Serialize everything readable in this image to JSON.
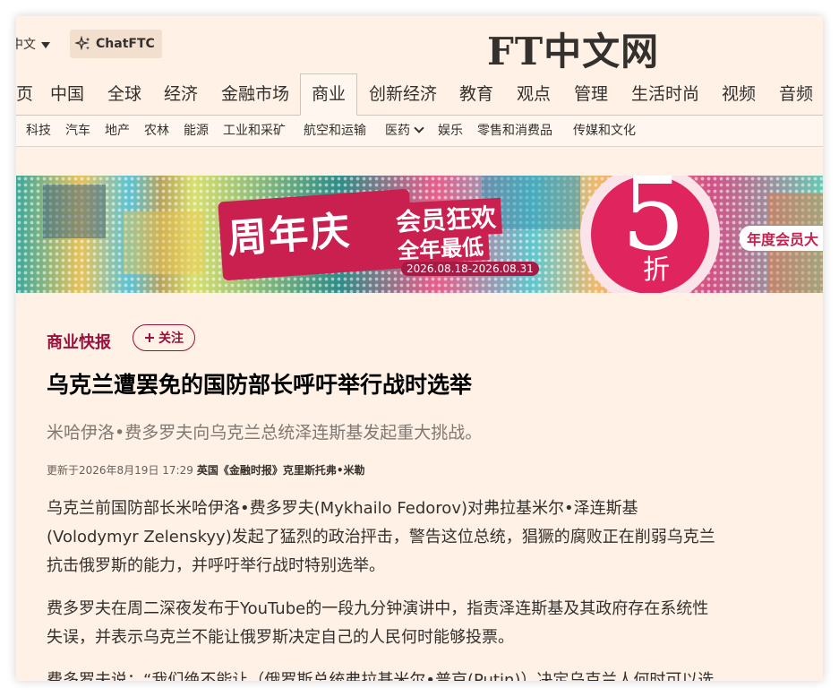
{
  "header": {
    "language_label": "中文",
    "chatftc_label": "ChatFTC",
    "logo": "FT中文网"
  },
  "main_nav": [
    "页",
    "中国",
    "全球",
    "经济",
    "金融市场",
    "商业",
    "创新经济",
    "教育",
    "观点",
    "管理",
    "生活时尚",
    "视频",
    "音频"
  ],
  "main_nav_active": "商业",
  "sub_nav": [
    "科技",
    "汽车",
    "地产",
    "农林",
    "能源",
    "工业和采矿",
    "航空和运输",
    "医药",
    "娱乐",
    "零售和消费品",
    "传媒和文化"
  ],
  "banner": {
    "title": "周年庆",
    "line1": "会员狂欢",
    "line2": "全年最低",
    "dates": "2026.08.18-2026.08.31",
    "discount_number": "5",
    "discount_unit": "折",
    "side_text": "年度会员大"
  },
  "article": {
    "kicker": "商业快报",
    "follow_label": "关注",
    "headline": "乌克兰遭罢免的国防部长呼吁举行战时选举",
    "standfirst": "米哈伊洛•费多罗夫向乌克兰总统泽连斯基发起重大挑战。",
    "updated": "更新于2026年8月19日 17:29",
    "author": "英国《金融时报》克里斯托弗•米勒",
    "paragraphs": [
      [
        "乌克兰前国防部长米哈伊洛•费多罗夫(Mykhailo Fedorov)对弗拉基米尔•泽连斯基",
        "(Volodymyr Zelenskyy)发起了猛烈的政治抨击，警告这位总统，猖獗的腐败正在削弱乌克兰",
        "抗击俄罗斯的能力，并呼吁举行战时特别选举。"
      ],
      [
        "费多罗夫在周二深夜发布于YouTube的一段九分钟演讲中，指责泽连斯基及其政府存在系统性",
        "失误，并表示乌克兰不能让俄罗斯决定自己的人民何时能够投票。"
      ],
      [
        "费多罗夫说：“我们绝不能让（俄罗斯总统弗拉基米尔•普京(Putin)）决定乌克兰人何时可以选"
      ]
    ]
  },
  "colors": {
    "page_bg": "#fff1e5",
    "accent": "#990f3d",
    "banner_red": "#c9204f"
  }
}
